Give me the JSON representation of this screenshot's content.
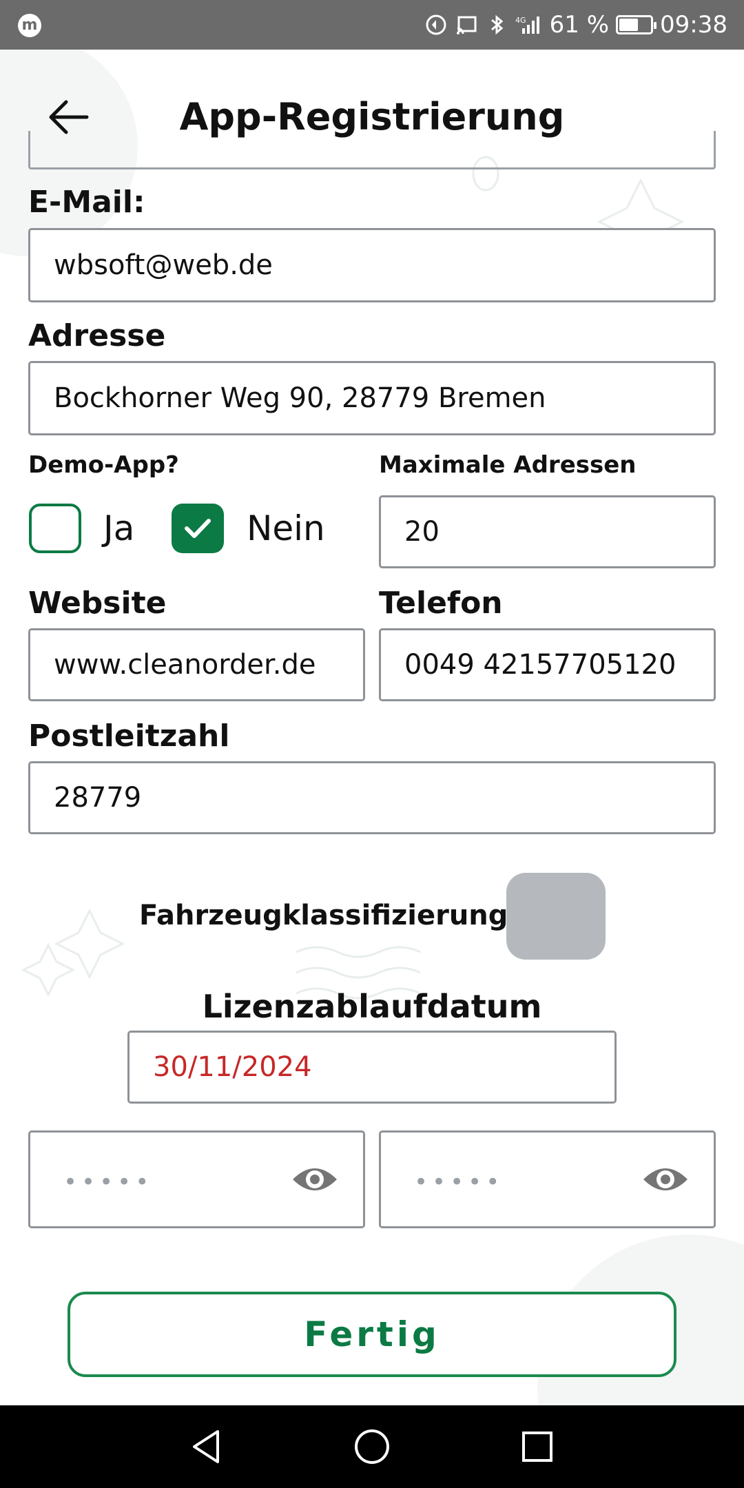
{
  "status_bar": {
    "battery_percent": "61 %",
    "battery_level": 0.61,
    "time": "09:38",
    "icons": [
      "app-logo-icon",
      "data-saver-icon",
      "cast-icon",
      "bluetooth-icon",
      "signal-4g-icon",
      "battery-icon"
    ]
  },
  "header": {
    "title": "App-Registrierung",
    "back_icon": "arrow-left-icon"
  },
  "form": {
    "email": {
      "label": "E-Mail:",
      "value": "wbsoft@web.de"
    },
    "address": {
      "label": "Adresse",
      "value": "Bockhorner Weg 90, 28779 Bremen"
    },
    "demo_app": {
      "label": "Demo-App?",
      "options": [
        {
          "label": "Ja",
          "checked": false
        },
        {
          "label": "Nein",
          "checked": true
        }
      ]
    },
    "max_addresses": {
      "label": "Maximale Adressen",
      "value": "20"
    },
    "website": {
      "label": "Website",
      "value": "www.cleanorder.de"
    },
    "phone": {
      "label": "Telefon",
      "value": "0049 42157705120"
    },
    "postal_code": {
      "label": "Postleitzahl",
      "value": "28779"
    },
    "vehicle_classification": {
      "label": "Fahrzeugklassifizierung",
      "enabled": false
    },
    "license_expiry": {
      "label": "Lizenzablaufdatum",
      "value": "30/11/2024"
    },
    "password": {
      "masked_value": "•••••",
      "icon": "eye-icon"
    },
    "password_confirm": {
      "masked_value": "•••••",
      "icon": "eye-icon"
    }
  },
  "actions": {
    "done_label": "Fertig"
  },
  "colors": {
    "accent_green": "#0b7a44",
    "button_border": "#1b8a4e",
    "date_red": "#c62828",
    "toggle_gray": "#b5b8bc",
    "statusbar_gray": "#6b6b6b"
  },
  "nav_bar": {
    "icons": [
      "back-triangle-icon",
      "home-circle-icon",
      "recents-square-icon"
    ]
  }
}
